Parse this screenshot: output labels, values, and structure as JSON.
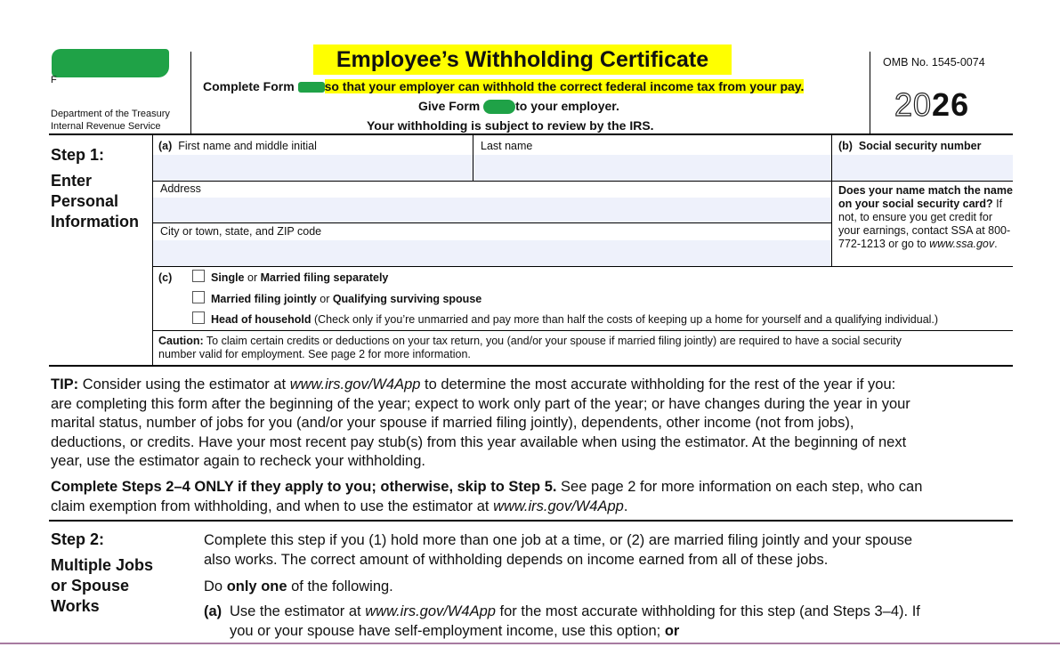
{
  "header": {
    "form_label_partial": "F",
    "title": "Employee’s Withholding Certificate",
    "line1_prefix": "Complete Form",
    "line1_rest": "so that your employer can withhold the correct federal income tax from your pay.",
    "line2_prefix": "Give Form",
    "line2_rest": "to your employer.",
    "line3": "Your withholding is subject to review by the IRS.",
    "dept_line1": "Department of the Treasury",
    "dept_line2": "Internal Revenue Service",
    "omb": "OMB No. 1545-0074",
    "year_outline": "20",
    "year_bold": "26"
  },
  "step1": {
    "heading_line1": "Step 1:",
    "heading_line2": "Enter",
    "heading_line3": "Personal",
    "heading_line4": "Information",
    "field_a_tag": "(a)",
    "field_a_label": "First name and middle initial",
    "last_name_label": "Last name",
    "field_b_tag": "(b)",
    "field_b_label": "Social security number",
    "address_label": "Address",
    "city_label": "City or town, state, and ZIP code",
    "ssa_bold": "Does your name match the name on your social security card?",
    "ssa_rest": " If not, to ensure you get credit for your earnings, contact SSA at 800-772-1213 or go to ",
    "ssa_url": "www.ssa.gov",
    "ssa_end": ".",
    "c_tag": "(c)",
    "options": [
      {
        "bold1": "Single",
        "mid": " or ",
        "bold2": "Married filing separately",
        "rest": ""
      },
      {
        "bold1": "Married filing jointly",
        "mid": " or ",
        "bold2": "Qualifying surviving spouse",
        "rest": ""
      },
      {
        "bold1": "Head of household",
        "mid": "",
        "bold2": "",
        "rest": " (Check only if you’re unmarried and pay more than half the costs of keeping up a home for yourself and a qualifying individual.)"
      }
    ],
    "caution_bold": "Caution:",
    "caution_line1": " To claim certain credits or deductions on your tax return, you (and/or your spouse if married filing jointly) are required to have a social security",
    "caution_line2": "number valid for employment. See page 2 for more information."
  },
  "tip": {
    "bold": "TIP:",
    "l1a": " Consider using the estimator at ",
    "l1url": "www.irs.gov/W4App",
    "l1b": " to determine the most accurate withholding for the rest of the year if you:",
    "l2": "are completing this form after the beginning of the year; expect to work only part of the year; or have changes during the year in your",
    "l3": "marital status, number of jobs for you (and/or your spouse if married filing jointly), dependents, other income (not from jobs),",
    "l4": "deductions, or credits. Have your most recent pay stub(s) from this year available when using the estimator. At the beginning of next",
    "l5": "year, use the estimator again to recheck your withholding."
  },
  "complete": {
    "bold": "Complete Steps 2–4 ONLY if they apply to you; otherwise, skip to Step 5.",
    "l1rest": " See page 2 for more information on each step, who can",
    "l2a": "claim exemption from withholding, and when to use the estimator at ",
    "l2url": "www.irs.gov/W4App",
    "l2b": "."
  },
  "step2": {
    "heading_line1": "Step 2:",
    "heading_line2": "Multiple Jobs",
    "heading_line3": "or Spouse",
    "heading_line4": "Works",
    "p1l1": "Complete this step if you (1) hold more than one job at a time, or (2) are married filing jointly and your spouse",
    "p1l2": "also works. The correct amount of withholding depends on income earned from all of these jobs.",
    "do_a": "Do ",
    "do_bold": "only one",
    "do_b": " of the following.",
    "a_tag": "(a)",
    "a_l1a": "Use the estimator at ",
    "a_url": "www.irs.gov/W4App",
    "a_l1b": " for the most accurate withholding for this step (and Steps 3–4). If",
    "a_l2a": "you or your spouse have self-employment income, use this option; ",
    "a_l2b": "or"
  }
}
